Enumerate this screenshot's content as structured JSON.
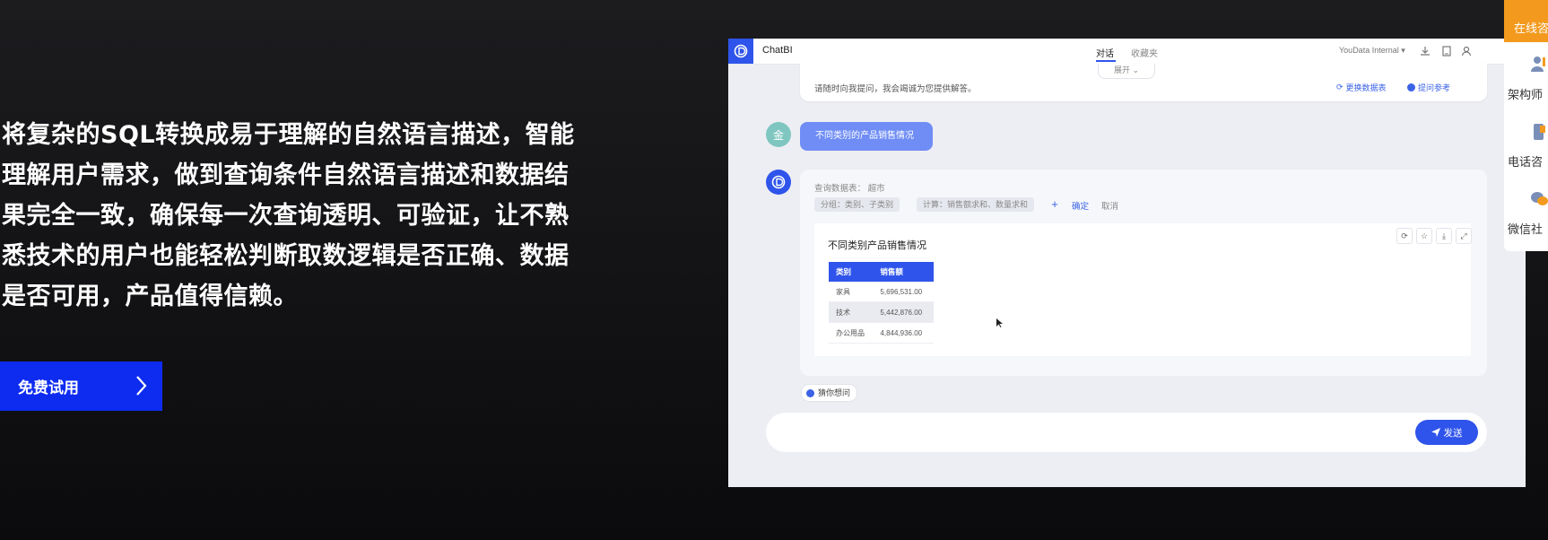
{
  "hero": {
    "lines": [
      "将复杂的SQL转换成易于理解的自然语言描述，智能",
      "理解用户需求，做到查询条件自然语言描述和数据结",
      "果完全一致，确保每一次查询透明、可验证，让不熟",
      "悉技术的用户也能轻松判断取数逻辑是否正确、数据",
      "是否可用，产品值得信赖。"
    ],
    "cta_label": "免费试用"
  },
  "app": {
    "title": "ChatBI",
    "tabs": [
      "对话",
      "收藏夹"
    ],
    "workspace": "YouData Internal",
    "expand_label": "展开",
    "intro_text": "请随时向我提问，我会竭诚为您提供解答。",
    "change_table_label": "更换数据表",
    "ask_ref_label": "提问参考",
    "user_avatar_char": "金",
    "user_question": "不同类别的产品销售情况",
    "query_table": "查询数据表：  超市",
    "chips": [
      "分组：类别、子类别",
      "计算：销售额求和、数量求和"
    ],
    "confirm_label": "确定",
    "cancel_label": "取消",
    "result_title": "不同类别产品销售情况",
    "table": {
      "headers": [
        "类别",
        "销售额"
      ],
      "rows": [
        [
          "家具",
          "5,696,531.00"
        ],
        [
          "技术",
          "5,442,876.00"
        ],
        [
          "办公用品",
          "4,844,936.00"
        ]
      ]
    },
    "suggest_label": "猜你想问",
    "send_label": "发送"
  },
  "side_panel": {
    "top_label": "在线咨",
    "items": [
      "架构师",
      "电话咨",
      "微信社"
    ]
  },
  "colors": {
    "cta": "#0d2cf0",
    "brand": "#2f54eb",
    "side_accent": "#f39a1e"
  }
}
